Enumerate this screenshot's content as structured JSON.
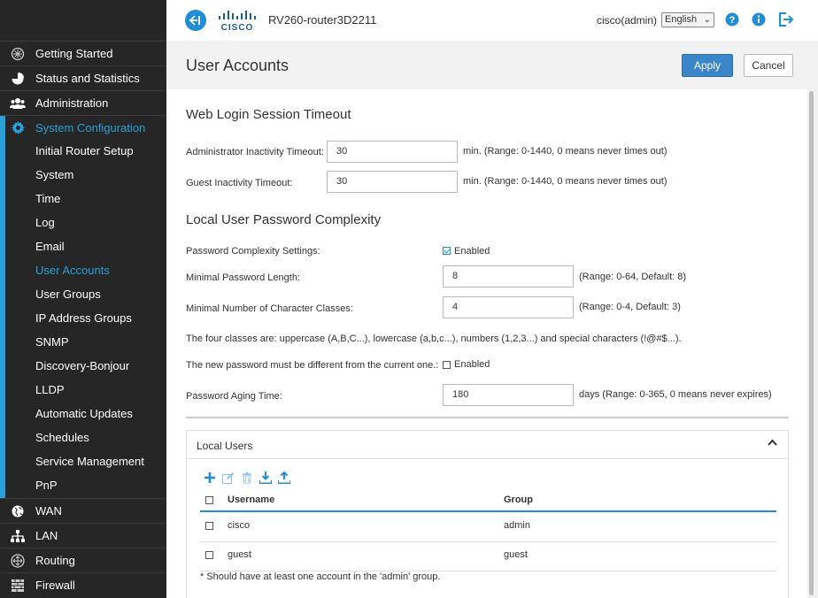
{
  "header": {
    "device_name": "RV260-router3D2211",
    "user": "cisco(admin)",
    "language": "English",
    "logo_text": "CISCO"
  },
  "sidebar": {
    "items": [
      {
        "label": "Getting Started",
        "icon": "getting-started-icon"
      },
      {
        "label": "Status and Statistics",
        "icon": "pie-chart-icon"
      },
      {
        "label": "Administration",
        "icon": "users-icon"
      },
      {
        "label": "System Configuration",
        "icon": "gear-icon",
        "active": true
      },
      {
        "label": "WAN",
        "icon": "globe-icon"
      },
      {
        "label": "LAN",
        "icon": "network-icon"
      },
      {
        "label": "Routing",
        "icon": "routing-icon"
      },
      {
        "label": "Firewall",
        "icon": "firewall-icon"
      }
    ],
    "sub_items": [
      "Initial Router Setup",
      "System",
      "Time",
      "Log",
      "Email",
      "User Accounts",
      "User Groups",
      "IP Address Groups",
      "SNMP",
      "Discovery-Bonjour",
      "LLDP",
      "Automatic Updates",
      "Schedules",
      "Service Management",
      "PnP"
    ],
    "active_sub": "User Accounts"
  },
  "page": {
    "title": "User Accounts",
    "apply_label": "Apply",
    "cancel_label": "Cancel"
  },
  "session": {
    "title": "Web Login Session Timeout",
    "admin_label": "Administrator Inactivity Timeout:",
    "admin_value": "30",
    "admin_hint": "min. (Range: 0-1440, 0 means never times out)",
    "guest_label": "Guest Inactivity Timeout:",
    "guest_value": "30",
    "guest_hint": "min. (Range: 0-1440, 0 means never times out)"
  },
  "complexity": {
    "title": "Local User Password Complexity",
    "settings_label": "Password Complexity Settings:",
    "settings_value": "Enabled",
    "min_length_label": "Minimal Password Length:",
    "min_length_value": "8",
    "min_length_hint": "(Range: 0-64, Default: 8)",
    "min_classes_label": "Minimal Number of Character Classes:",
    "min_classes_value": "4",
    "min_classes_hint": "(Range: 0-4, Default: 3)",
    "classes_note": "The four classes are: uppercase (A,B,C...), lowercase (a,b,c...), numbers (1,2,3...) and special characters (!@#$...).",
    "different_label": "The new password must be different from the current one.:",
    "different_value": "Enabled",
    "aging_label": "Password Aging Time:",
    "aging_value": "180",
    "aging_hint": "days (Range: 0-365, 0 means never expires)"
  },
  "local_users": {
    "title": "Local Users",
    "columns": [
      "Username",
      "Group"
    ],
    "rows": [
      {
        "username": "cisco",
        "group": "admin"
      },
      {
        "username": "guest",
        "group": "guest"
      }
    ],
    "note": "* Should have at least one account in the 'admin' group."
  },
  "colors": {
    "accent": "#2a9fd8",
    "sidebar_bg": "#262626",
    "apply_bg": "#3b86c9"
  }
}
